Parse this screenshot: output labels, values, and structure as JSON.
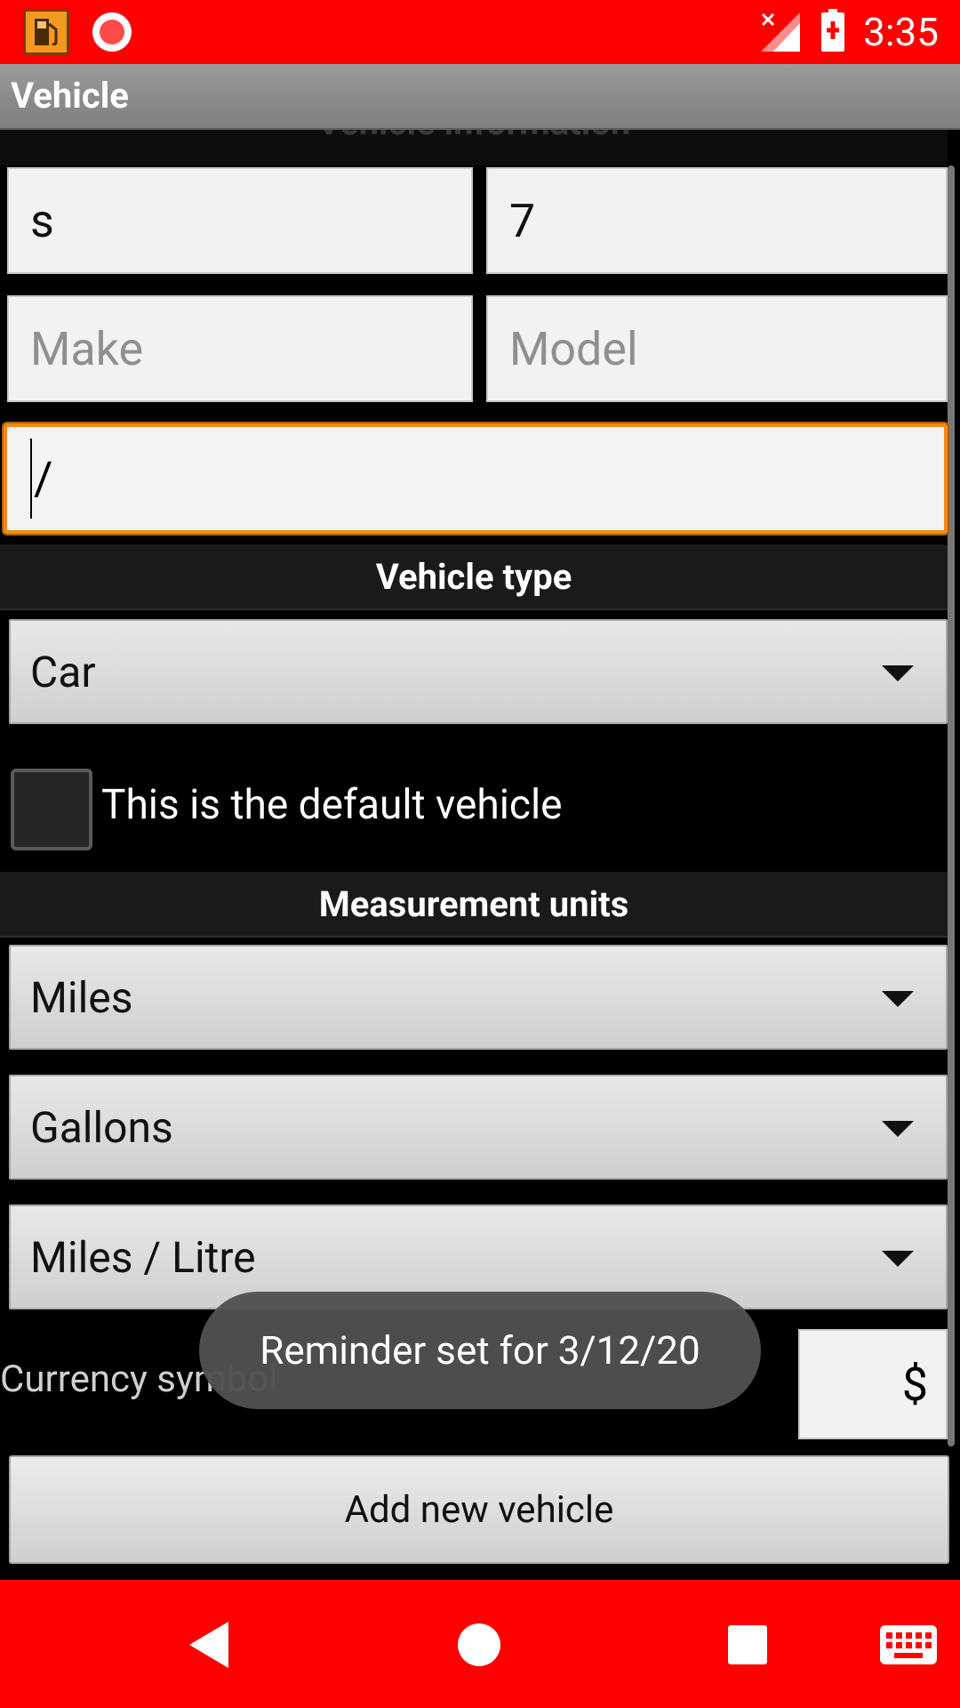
{
  "status_bar": {
    "time": "3:35",
    "icons": [
      "fuel-app-icon",
      "record-icon",
      "no-signal-icon",
      "battery-charging-icon"
    ]
  },
  "action_bar": {
    "title": "Vehicle"
  },
  "section_cut_title": "Vehicle information",
  "fields": {
    "name_value": "s",
    "number_value": "7",
    "make_placeholder": "Make",
    "model_placeholder": "Model",
    "focused_value": "/"
  },
  "vehicle_type": {
    "header": "Vehicle type",
    "selected": "Car"
  },
  "default_vehicle": {
    "label": "This is the default vehicle",
    "checked": false
  },
  "measurement_units": {
    "header": "Measurement units",
    "distance": "Miles",
    "volume": "Gallons",
    "economy": "Miles / Litre"
  },
  "currency": {
    "label": "Currency symbol",
    "value": "$"
  },
  "add_button_label": "Add new vehicle",
  "toast": "Reminder set for 3/12/20",
  "nav_bar": {
    "icons": [
      "back-icon",
      "home-icon",
      "recents-icon",
      "keyboard-icon"
    ]
  },
  "colors": {
    "system_bars": "#ff0000",
    "focus_border": "#f08a1c"
  }
}
